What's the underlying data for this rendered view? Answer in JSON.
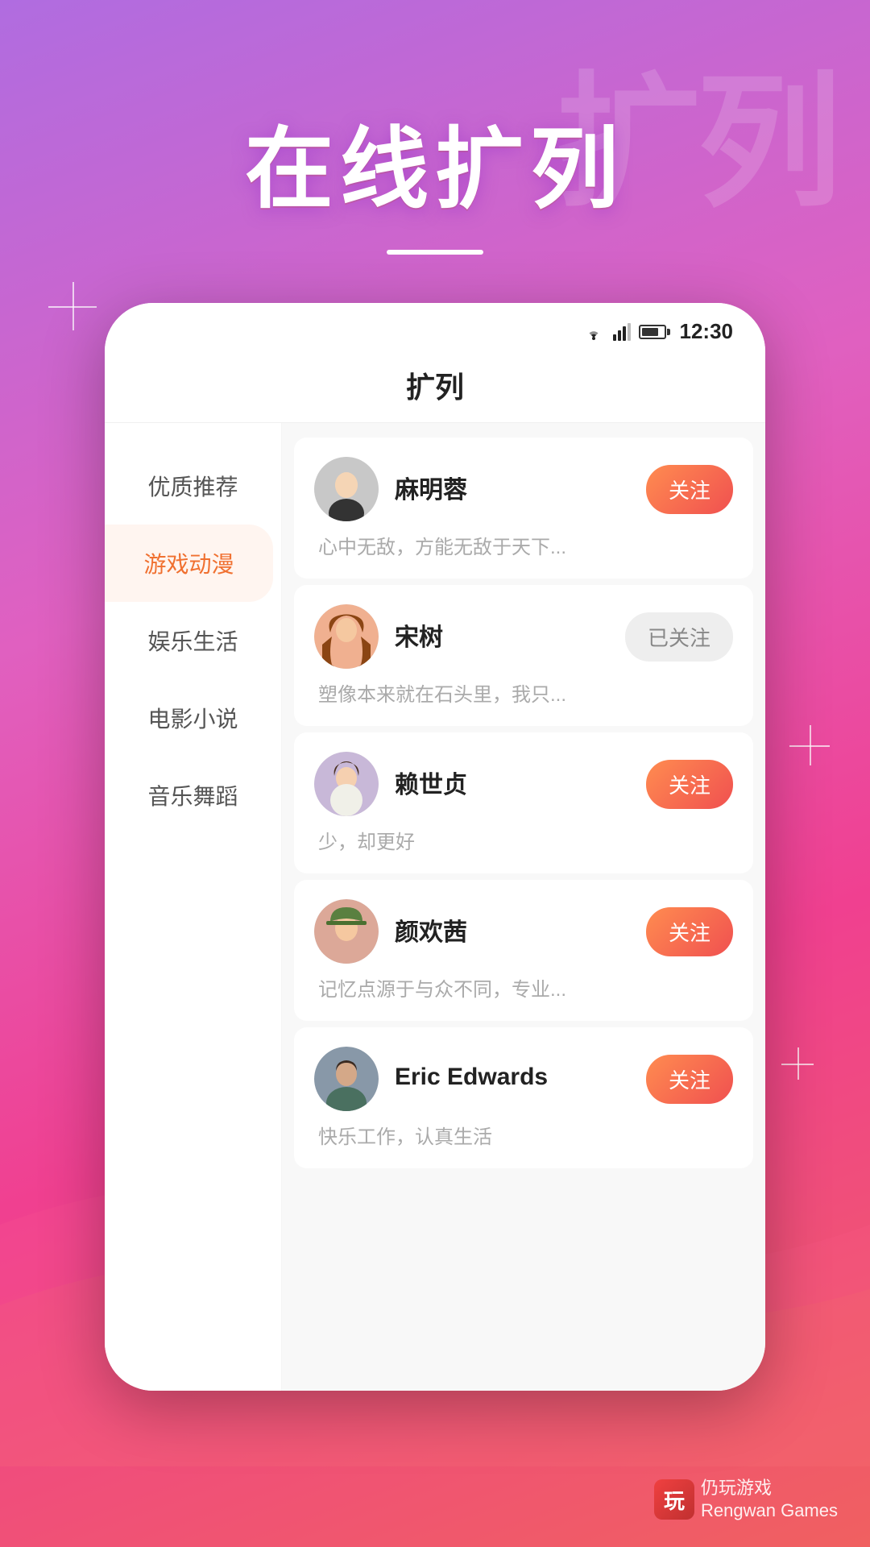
{
  "background": {
    "bg_text": "扩列"
  },
  "title_area": {
    "main_title": "在线扩列",
    "divider": true
  },
  "status_bar": {
    "time": "12:30"
  },
  "app_header": {
    "title": "扩列"
  },
  "sidebar": {
    "items": [
      {
        "id": "quality",
        "label": "优质推荐",
        "active": false
      },
      {
        "id": "game",
        "label": "游戏动漫",
        "active": true
      },
      {
        "id": "entertainment",
        "label": "娱乐生活",
        "active": false
      },
      {
        "id": "movie",
        "label": "电影小说",
        "active": false
      },
      {
        "id": "music",
        "label": "音乐舞蹈",
        "active": false
      }
    ]
  },
  "users": [
    {
      "id": 1,
      "name": "麻明蓉",
      "desc": "心中无敌，方能无敌于天下...",
      "follow_status": "unfollow",
      "follow_label": "关注",
      "avatar_class": "avatar-1"
    },
    {
      "id": 2,
      "name": "宋树",
      "desc": "塑像本来就在石头里，我只...",
      "follow_status": "following",
      "follow_label": "已关注",
      "avatar_class": "avatar-2"
    },
    {
      "id": 3,
      "name": "赖世贞",
      "desc": "少，却更好",
      "follow_status": "unfollow",
      "follow_label": "关注",
      "avatar_class": "avatar-3"
    },
    {
      "id": 4,
      "name": "颜欢茜",
      "desc": "记忆点源于与众不同，专业...",
      "follow_status": "unfollow",
      "follow_label": "关注",
      "avatar_class": "avatar-4"
    },
    {
      "id": 5,
      "name": "Eric Edwards",
      "desc": "快乐工作，认真生活",
      "follow_status": "unfollow",
      "follow_label": "关注",
      "avatar_class": "avatar-5"
    }
  ],
  "brand": {
    "logo": "玩",
    "line1": "仍玩游戏",
    "line2": "Rengwan Games"
  }
}
